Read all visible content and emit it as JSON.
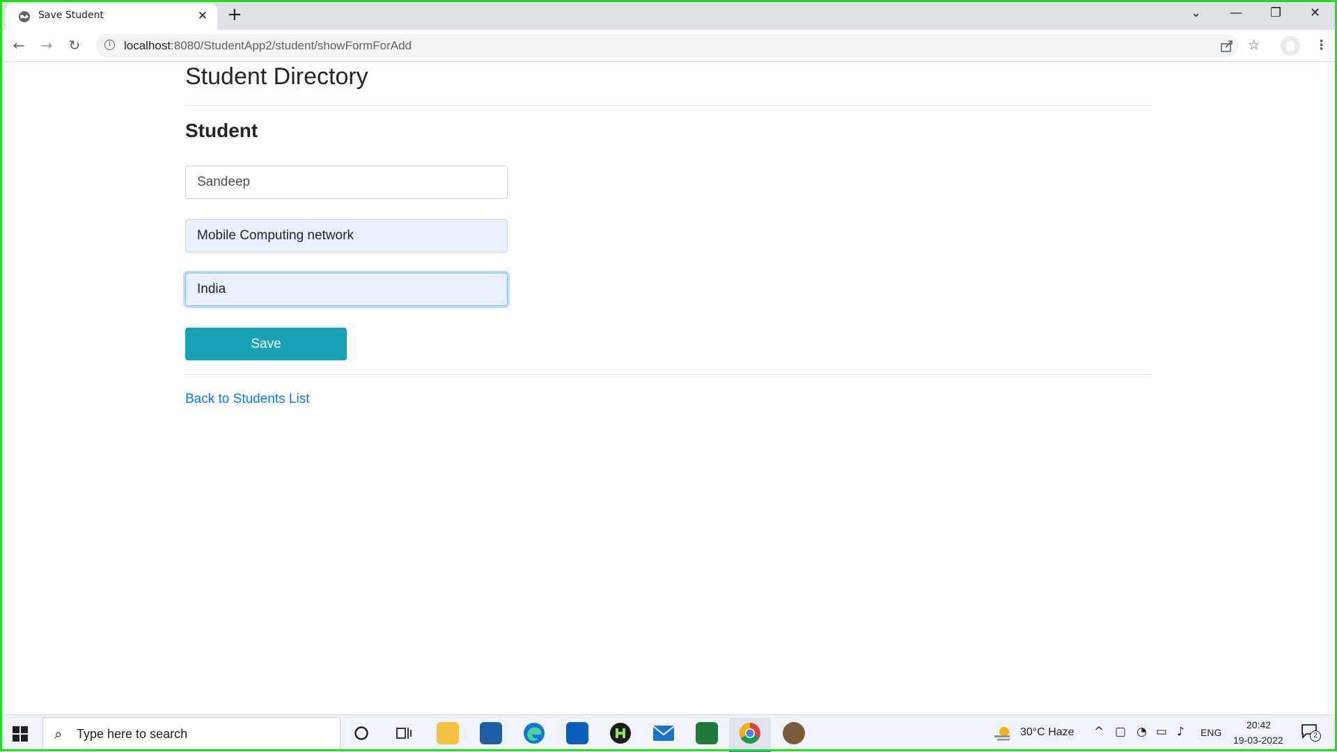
{
  "browser": {
    "tab_title": "Save Student",
    "tab_close": "✕",
    "new_tab": "+",
    "url_host": "localhost",
    "url_path": ":8080/StudentApp2/student/showFormForAdd",
    "controls": {
      "dropdown": "⌄",
      "minimize": "—",
      "restore": "❐",
      "close": "✕"
    }
  },
  "page": {
    "title": "Student Directory",
    "section_title": "Student",
    "fields": [
      {
        "name": "first-name",
        "value": "Sandeep"
      },
      {
        "name": "course",
        "value": "Mobile Computing network"
      },
      {
        "name": "country",
        "value": "India"
      }
    ],
    "save_label": "Save",
    "back_link": "Back to Students List"
  },
  "taskbar": {
    "search_placeholder": "Type here to search",
    "weather": "30°C  Haze",
    "language": "ENG",
    "time": "20:42",
    "date": "19-03-2022",
    "notification_count": "2"
  },
  "colors": {
    "accent_button": "#17a2b8",
    "link": "#007bff",
    "frame": "#22dd22"
  }
}
